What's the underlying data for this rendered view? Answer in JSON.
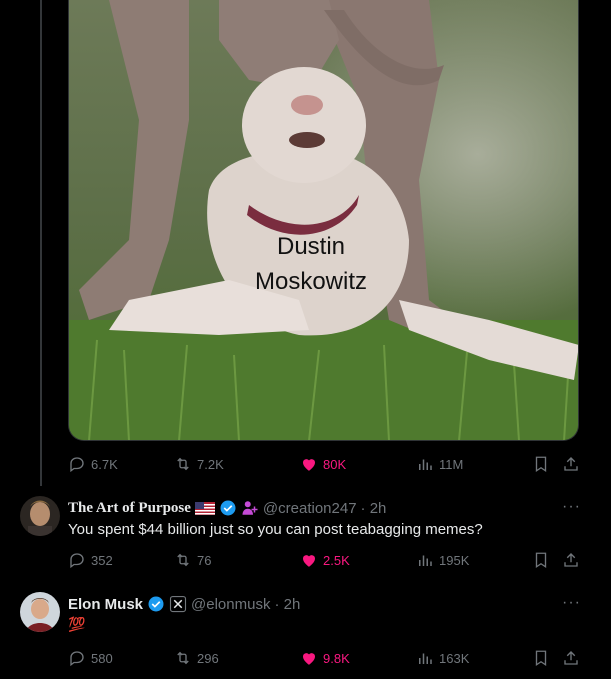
{
  "top_post": {
    "image_caption_line1": "Dustin",
    "image_caption_line2": "Moskowitz",
    "replies": "6.7K",
    "reposts": "7.2K",
    "likes": "80K",
    "views": "11M"
  },
  "reply1": {
    "display_name": "The Art of Purpose",
    "handle": "@creation247",
    "time": "· 2h",
    "text": "You spent $44 billion just so you can post teabagging memes?",
    "replies": "352",
    "reposts": "76",
    "likes": "2.5K",
    "views": "195K",
    "more": "···"
  },
  "reply2": {
    "display_name": "Elon Musk",
    "handle": "@elonmusk",
    "time": "· 2h",
    "text": "💯",
    "replies": "580",
    "reposts": "296",
    "likes": "9.8K",
    "views": "163K",
    "more": "···"
  },
  "colors": {
    "background": "#000000",
    "muted": "#71767b",
    "like_pink": "#f91880",
    "verified_blue": "#1d9bf0"
  }
}
